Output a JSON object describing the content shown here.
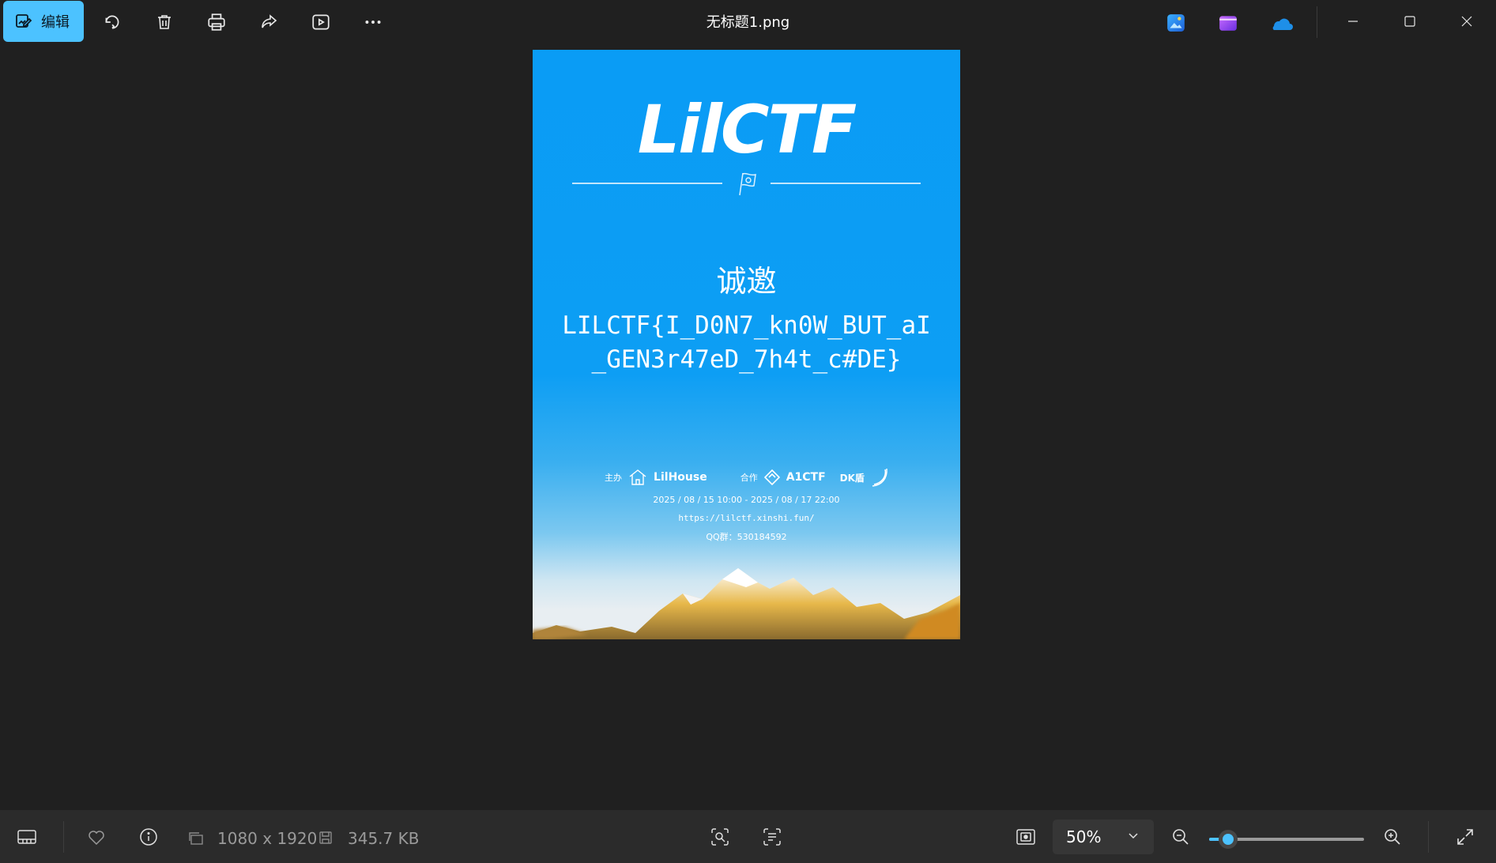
{
  "window": {
    "title": "无标题1.png"
  },
  "toolbar": {
    "edit_label": "编辑",
    "icons": [
      "edit-icon",
      "rotate-icon",
      "delete-icon",
      "print-icon",
      "share-icon",
      "slideshow-icon",
      "more-icon"
    ]
  },
  "app_icons": [
    "photo-editor-icon",
    "clipchamp-icon",
    "onedrive-icon"
  ],
  "window_controls": [
    "minimize-icon",
    "maximize-icon",
    "close-icon"
  ],
  "poster": {
    "logo": "LilCTF",
    "invite": "诚邀",
    "flag_text": "LILCTF{I_D0N7_kn0W_BUT_aI_GEN3r47eD_7h4t_c#DE}",
    "host_label": "主办",
    "host_name": "LilHouse",
    "partner_label": "合作",
    "partner_name": "A1CTF",
    "partner2_name": "DK盾",
    "dates": "2025 / 08 / 15  10:00  -  2025 / 08 / 17  22:00",
    "url": "https://lilctf.xinshi.fun/",
    "qq": "QQ群：530184592"
  },
  "bottombar": {
    "dimensions": "1080 x 1920",
    "file_size": "345.7 KB",
    "zoom_value": "50%",
    "zoom_level": 0.12
  },
  "colors": {
    "accent": "#4cc2ff",
    "background": "#202020",
    "bottombar": "#2b2b2b"
  }
}
